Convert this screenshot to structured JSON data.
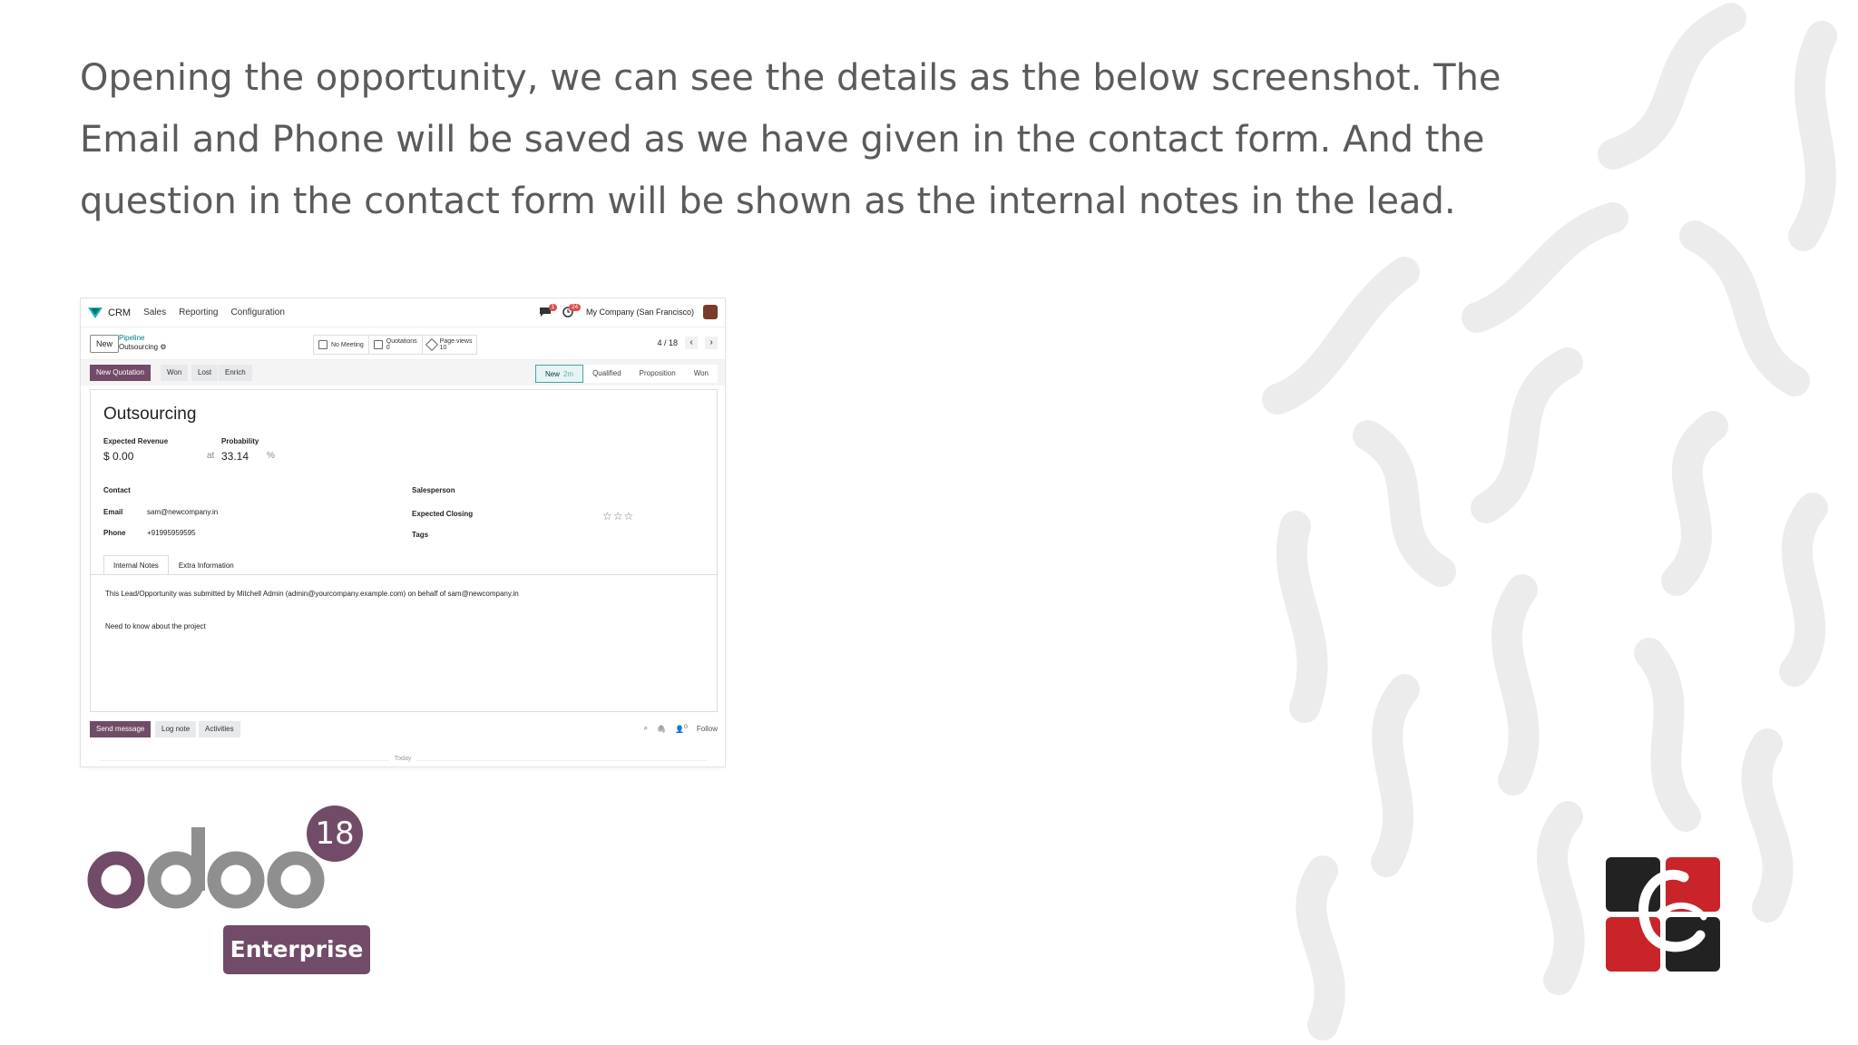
{
  "intro_text": "Opening the opportunity, we can see the details as the below screenshot. The Email and Phone will be saved as we have given in the contact form. And the question in the contact form will be shown as the internal notes in the lead.",
  "app": {
    "name": "CRM",
    "menu": [
      "Sales",
      "Reporting",
      "Configuration"
    ],
    "notifications": {
      "messages": "1",
      "activities": "24"
    },
    "company": "My Company (San Francisco)"
  },
  "control": {
    "new_label": "New",
    "breadcrumb_parent": "Pipeline",
    "breadcrumb_current": "Outsourcing",
    "stats": [
      {
        "label": "No Meeting",
        "value": ""
      },
      {
        "label": "Quotations",
        "value": "0"
      },
      {
        "label": "Page views",
        "value": "10"
      }
    ],
    "pager": "4 / 18"
  },
  "actions": [
    "New Quotation",
    "Won",
    "Lost",
    "Enrich"
  ],
  "stages": {
    "current": "New",
    "current_duration": "2m",
    "others": [
      "Qualified",
      "Proposition",
      "Won"
    ]
  },
  "form": {
    "title": "Outsourcing",
    "expected_revenue_label": "Expected Revenue",
    "expected_revenue": "$ 0.00",
    "probability_label": "Probability",
    "probability_at": "at",
    "probability": "33.14",
    "percent": "%",
    "contact_label": "Contact",
    "email_label": "Email",
    "email": "sam@newcompany.in",
    "phone_label": "Phone",
    "phone": "+91995959595",
    "salesperson_label": "Salesperson",
    "expected_closing_label": "Expected Closing",
    "tags_label": "Tags",
    "priority_stars": "☆☆☆",
    "tabs": [
      "Internal Notes",
      "Extra Information"
    ],
    "note_line1": "This Lead/Opportunity was submitted by Mitchell Admin (admin@yourcompany.example.com) on behalf of sam@newcompany.in",
    "note_line2": "Need to know about the project"
  },
  "chatter": {
    "send_message": "Send message",
    "log_note": "Log note",
    "activities": "Activities",
    "followers_count": "0",
    "follow": "Follow",
    "today": "Today"
  },
  "branding": {
    "odoo_version": "18",
    "edition": "Enterprise",
    "brand_color": "#714b67"
  }
}
